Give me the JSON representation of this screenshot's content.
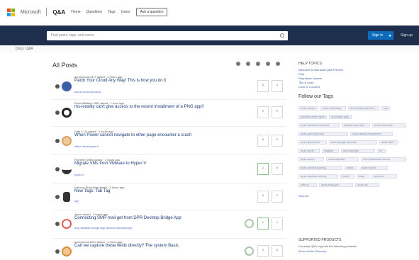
{
  "header": {
    "brand": "Microsoft",
    "product": "Q&A",
    "product_sub": "Home",
    "nav": [
      "Questions",
      "Tags",
      "Users"
    ],
    "ask_button": "Ask a question"
  },
  "search": {
    "placeholder": "Find posts, tags, and users..."
  },
  "account": {
    "signin": "Sign in",
    "signup": "Sign up"
  },
  "breadcrumb": [
    "Docs",
    "Q&A"
  ],
  "main": {
    "title": "All Posts"
  },
  "posts": [
    {
      "meta": "anonymous-4477 asked · 2 hours ago",
      "title": "Patch Your Cloud Any Way! This is how you do it",
      "tags": "azure-cloud-services",
      "votes": "0",
      "answers": "0",
      "avatar_color": "#3d5fa8"
    },
    {
      "meta": "Ross-Williams 1801 asked · 1 hour ago",
      "title": "ms-ionality can't give access to the recent installment of a PNG app!!",
      "tags": "",
      "votes": "0",
      "answers": "0",
      "avatar_color": "#222222"
    },
    {
      "meta": "Gale-1711 asked · 2 hours ago",
      "title": "When Power cannot navigate to other page encounter a crash",
      "tags": "office-development",
      "votes": "0",
      "answers": "0",
      "avatar_color": "#d9a066"
    },
    {
      "meta": "Filament Metea asked · 3 hours ago",
      "title": "Migrate VMs from VMware to Hyper-V",
      "tags": "hyper-v",
      "votes": "1",
      "answers": "0",
      "avatar_color": "#333333"
    },
    {
      "meta": "Harbour Ruby-Man asked · 3 hours ago",
      "title": "New Tags: Tab Tag",
      "tags": "tag",
      "votes": "0",
      "answers": "1",
      "avatar_color": "#222222"
    },
    {
      "meta": "Aaron asked · 3 hours ago",
      "title": "Connecting SMR mail get from DPR Desktop Bridge App",
      "tags": "uwp   desktop-bridge   uwp-devices   windows-api",
      "votes": "1",
      "answers": "1",
      "avatar_color": "#ffffff"
    },
    {
      "meta": "anonymous-8014 asked · 4 hours ago",
      "title": "Can we capture these fields directly? The system Basic",
      "tags": "",
      "votes": "0",
      "answers": "0",
      "avatar_color": "#d98e3c"
    }
  ],
  "sidebar": {
    "help_heading": "HELP TOPICS",
    "help_links": [
      "Welcome to Microsoft Q&A Preview",
      "FAQ",
      "Reputation system",
      "Tips & tricks",
      "Code of Conduct"
    ],
    "follow_title": "Follow our Tags",
    "tags": [
      [
        "azure-devops",
        "azure-networking",
        "azure-virtual-machines",
        "uwp"
      ],
      [
        "windows-server-hyperv",
        "azure-logic-apps"
      ],
      [
        "azure-functions-extensions",
        "windows-uwp-xaml",
        "azure-cosmos-db"
      ],
      [
        "azure-active-directory",
        "azure-data-factory-general"
      ],
      [
        "azure-app-service",
        "azure-storage-accounts",
        "azure-batch"
      ],
      [
        "azure-sql-db",
        "msgraph",
        "azure-synapse",
        "iot"
      ],
      [
        "azure-search",
        "azure-data-lake",
        "azure-kubernetes-service"
      ],
      [
        "azure-machine-learning",
        "intune",
        "azure-monitor"
      ],
      [
        "azure-cognitive-services",
        "dotnet",
        "bicep",
        "sql-server"
      ],
      [
        "office-js",
        "azure-event-grid",
        "azure-cdn"
      ]
    ],
    "view_all": "View all",
    "supported_heading": "SUPPORTED PRODUCTS",
    "supported_text": "Currently Q&A supports the following products",
    "supported_link": "Azure Active Directory"
  },
  "colors": {
    "searchbar": "#1e2f4d",
    "signin": "#0f6cbd",
    "link": "#1a3b7a"
  }
}
